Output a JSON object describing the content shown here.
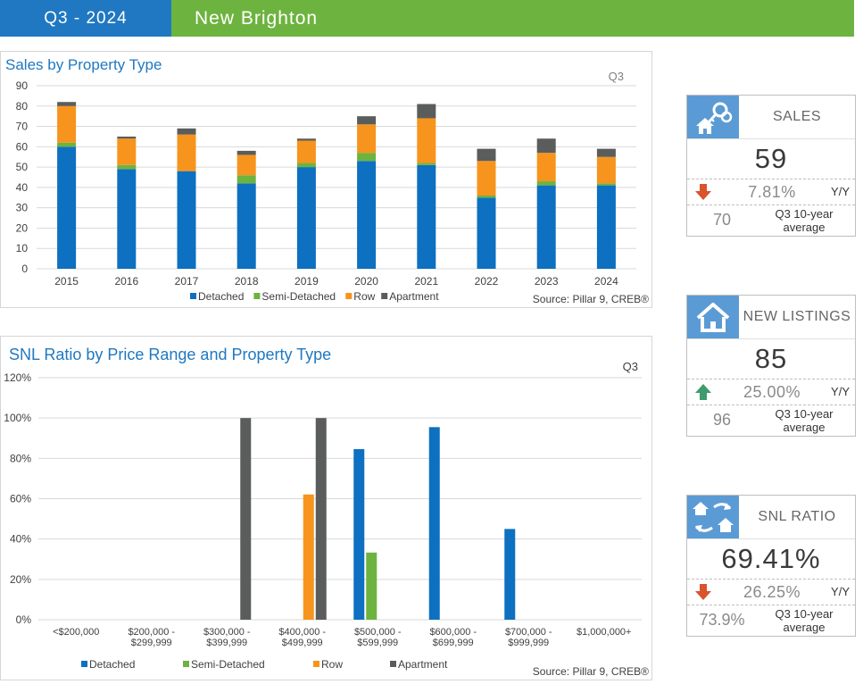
{
  "header": {
    "period": "Q3 - 2024",
    "area": "New Brighton"
  },
  "colors": {
    "detached": "#0d70c0",
    "semi_detached": "#6db33f",
    "row": "#f7941d",
    "apartment": "#5a5d5c",
    "header_blue": "#1f78c1",
    "header_green": "#6db33f",
    "arrow_down": "#d9532c",
    "arrow_up": "#3f9a6e"
  },
  "chart_data": [
    {
      "type": "bar",
      "stacked": true,
      "title": "Sales by Property Type",
      "tag": "Q3",
      "source": "Source: Pillar 9, CREB®",
      "categories": [
        "2015",
        "2016",
        "2017",
        "2018",
        "2019",
        "2020",
        "2021",
        "2022",
        "2023",
        "2024"
      ],
      "series": [
        {
          "name": "Detached",
          "values": [
            60,
            49,
            48,
            42,
            50,
            53,
            51,
            35,
            41,
            41
          ]
        },
        {
          "name": "Semi-Detached",
          "values": [
            2,
            2,
            0,
            4,
            2,
            4,
            1,
            1,
            2,
            1
          ]
        },
        {
          "name": "Row",
          "values": [
            18,
            13,
            18,
            10,
            11,
            14,
            22,
            17,
            14,
            13
          ]
        },
        {
          "name": "Apartment",
          "values": [
            2,
            1,
            3,
            2,
            1,
            4,
            7,
            6,
            7,
            4
          ]
        }
      ],
      "ylim": [
        0,
        90
      ],
      "yticks": [
        "0",
        "10",
        "20",
        "30",
        "40",
        "50",
        "60",
        "70",
        "80",
        "90"
      ],
      "grid": true,
      "legend": "bottom"
    },
    {
      "type": "bar",
      "title": "SNL Ratio by Price Range and Property Type",
      "tag": "Q3",
      "source": "Source: Pillar 9, CREB®",
      "categories": [
        [
          "<$200,000",
          ""
        ],
        [
          "$200,000 -",
          "$299,999"
        ],
        [
          "$300,000 -",
          "$399,999"
        ],
        [
          "$400,000 -",
          "$499,999"
        ],
        [
          "$500,000 -",
          "$599,999"
        ],
        [
          "$600,000 -",
          "$699,999"
        ],
        [
          "$700,000 -",
          "$999,999"
        ],
        [
          "$1,000,000+",
          ""
        ]
      ],
      "series": [
        {
          "name": "Detached",
          "values": [
            null,
            null,
            null,
            null,
            84.6,
            95.5,
            45.0,
            null
          ]
        },
        {
          "name": "Semi-Detached",
          "values": [
            null,
            null,
            null,
            null,
            33.3,
            null,
            null,
            null
          ]
        },
        {
          "name": "Row",
          "values": [
            null,
            null,
            null,
            62.1,
            null,
            null,
            null,
            null
          ]
        },
        {
          "name": "Apartment",
          "values": [
            null,
            null,
            100,
            100,
            null,
            null,
            null,
            null
          ]
        }
      ],
      "ylim": [
        0,
        120
      ],
      "yticks": [
        "0%",
        "20%",
        "40%",
        "60%",
        "80%",
        "100%",
        "120%"
      ],
      "grid": true,
      "legend": "bottom"
    }
  ],
  "cards": [
    {
      "label": "SALES",
      "icon": "keys-house-icon",
      "value": "59",
      "trend": "down",
      "yy_pct": "7.81%",
      "yy_label": "Y/Y",
      "avg_value": "70",
      "avg_label_1": "Q3 10-year",
      "avg_label_2": "average"
    },
    {
      "label": "NEW LISTINGS",
      "icon": "house-icon",
      "value": "85",
      "trend": "up",
      "yy_pct": "25.00%",
      "yy_label": "Y/Y",
      "avg_value": "96",
      "avg_label_1": "Q3 10-year",
      "avg_label_2": "average"
    },
    {
      "label": "SNL RATIO",
      "icon": "houses-exchange-icon",
      "value": "69.41%",
      "trend": "down",
      "yy_pct": "26.25%",
      "yy_label": "Y/Y",
      "avg_value": "73.9%",
      "avg_label_1": "Q3 10-year",
      "avg_label_2": "average"
    }
  ]
}
